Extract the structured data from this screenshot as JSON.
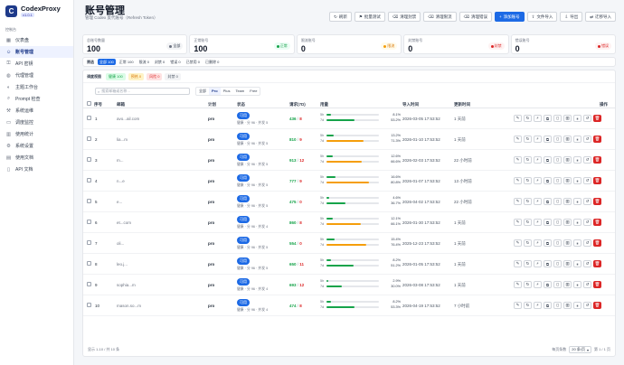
{
  "app": {
    "name": "CodexProxy",
    "version": "v1.0.1",
    "logo_letter": "C"
  },
  "sidebar": {
    "caption": "控制台",
    "items": [
      {
        "label": "仪表盘",
        "icon": "grid-icon",
        "glyph": "▦",
        "active": false
      },
      {
        "label": "账号管理",
        "icon": "users-icon",
        "glyph": "☺",
        "active": true
      },
      {
        "label": "API 密钥",
        "icon": "key-icon",
        "glyph": "⚿",
        "active": false
      },
      {
        "label": "代理管理",
        "icon": "globe-icon",
        "glyph": "◍",
        "active": false
      },
      {
        "label": "主题工作台",
        "icon": "palette-icon",
        "glyph": "◐",
        "active": false
      },
      {
        "label": "Prompt 检查",
        "icon": "search-icon",
        "glyph": "⌕",
        "active": false
      },
      {
        "label": "系统运维",
        "icon": "wrench-icon",
        "glyph": "⚒",
        "active": false
      },
      {
        "label": "调度监控",
        "icon": "monitor-icon",
        "glyph": "▭",
        "active": false
      },
      {
        "label": "使用统计",
        "icon": "chart-icon",
        "glyph": "▥",
        "active": false
      },
      {
        "label": "系统设置",
        "icon": "gear-icon",
        "glyph": "⚙",
        "active": false
      },
      {
        "label": "使用文档",
        "icon": "book-icon",
        "glyph": "▤",
        "active": false
      },
      {
        "label": "API 文档",
        "icon": "file-icon",
        "glyph": "▯",
        "active": false
      }
    ]
  },
  "header": {
    "title": "账号管理",
    "subtitle": "管理 Codex 反代账号（Refresh Token）",
    "buttons": [
      {
        "label": "刷新",
        "icon": "refresh-icon",
        "glyph": "↻",
        "primary": false
      },
      {
        "label": "批量测试",
        "icon": "test-icon",
        "glyph": "⚑",
        "primary": false
      },
      {
        "label": "清理封禁",
        "icon": "trash-icon",
        "glyph": "⌫",
        "primary": false
      },
      {
        "label": "清理限流",
        "icon": "trash-icon",
        "glyph": "⌫",
        "primary": false
      },
      {
        "label": "清理错误",
        "icon": "trash-icon",
        "glyph": "⌫",
        "primary": false
      },
      {
        "label": "添加账号",
        "icon": "plus-icon",
        "glyph": "+",
        "primary": true
      },
      {
        "label": "文件导入",
        "icon": "upload-icon",
        "glyph": "⇪",
        "primary": false
      },
      {
        "label": "导出",
        "icon": "download-icon",
        "glyph": "⇩",
        "primary": false
      },
      {
        "label": "迁移导入",
        "icon": "migrate-icon",
        "glyph": "⇄",
        "primary": false
      }
    ]
  },
  "stats": [
    {
      "label": "总账号数量",
      "value": "100",
      "badge": "全部",
      "badge_color": "#374151",
      "badge_bg": "#f3f4f6",
      "dot": "#6b7280"
    },
    {
      "label": "正常账号",
      "value": "100",
      "badge": "正常",
      "badge_color": "#16a34a",
      "badge_bg": "#ecfdf5",
      "dot": "#16a34a"
    },
    {
      "label": "限流账号",
      "value": "0",
      "badge": "限流",
      "badge_color": "#d97706",
      "badge_bg": "#fffbeb",
      "dot": "#f59e0b"
    },
    {
      "label": "封禁账号",
      "value": "0",
      "badge": "封禁",
      "badge_color": "#dc2626",
      "badge_bg": "#fef2f2",
      "dot": "#dc2626"
    },
    {
      "label": "错误账号",
      "value": "0",
      "badge": "错误",
      "badge_color": "#dc2626",
      "badge_bg": "#fef2f2",
      "dot": "#dc2626"
    }
  ],
  "filter": {
    "label": "筛选",
    "chips": [
      {
        "label": "全部 100",
        "active": true
      },
      {
        "label": "正常 100",
        "active": false
      },
      {
        "label": "限流 0",
        "active": false
      },
      {
        "label": "封禁 0",
        "active": false
      },
      {
        "label": "错误 0",
        "active": false
      },
      {
        "label": "已禁用 0",
        "active": false
      },
      {
        "label": "已删除 0",
        "active": false
      }
    ]
  },
  "dispatch": {
    "label": "调度视图",
    "pills": [
      {
        "label": "健康 100",
        "color": "#16a34a",
        "bg": "#dcfce7"
      },
      {
        "label": "预热 0",
        "color": "#d97706",
        "bg": "#fef3c7"
      },
      {
        "label": "风险 0",
        "color": "#dc2626",
        "bg": "#fee2e2"
      },
      {
        "label": "封禁 0",
        "color": "#4b5563",
        "bg": "#f3f4f6"
      }
    ]
  },
  "search": {
    "placeholder": "搜索邮箱或名称…"
  },
  "plan_filter": [
    {
      "label": "全部",
      "active": false
    },
    {
      "label": "Pro",
      "active": true
    },
    {
      "label": "Plus",
      "active": false
    },
    {
      "label": "Team",
      "active": false
    },
    {
      "label": "Free",
      "active": false
    }
  ],
  "table": {
    "columns": [
      "序号",
      "邮箱",
      "计划",
      "状态",
      "请求(7D)",
      "用量",
      "导入时间",
      "更新时间",
      "操作"
    ],
    "usage_labels": {
      "short": "5h",
      "long": "7d"
    },
    "rows": [
      {
        "idx": "1",
        "email": "avo...ail.com",
        "plan": "pro",
        "status": "可用",
        "sub": "健康 · 分 96 · 并发 5",
        "ok": "436",
        "err": "8",
        "u5": 8.1,
        "u5_text": "8.1%",
        "u7": 53.2,
        "u7_text": "53.2%",
        "imported": "2026-03-05 17:53:52",
        "updated": "1 天前"
      },
      {
        "idx": "2",
        "email": "lia...m",
        "plan": "pro",
        "status": "可用",
        "sub": "健康 · 分 96 · 并发 5",
        "ok": "810",
        "err": "9",
        "u5": 13.2,
        "u5_text": "13.2%",
        "u7": 71.3,
        "u7_text": "71.3%",
        "imported": "2026-01-10 17:53:52",
        "updated": "1 天前"
      },
      {
        "idx": "3",
        "email": "m...",
        "plan": "pro",
        "status": "可用",
        "sub": "健康 · 分 96 · 并发 5",
        "ok": "913",
        "err": "12",
        "u5": 12.6,
        "u5_text": "12.6%",
        "u7": 66.6,
        "u7_text": "66.6%",
        "imported": "2026-02-03 17:53:52",
        "updated": "22 小时前"
      },
      {
        "idx": "4",
        "email": "n...e",
        "plan": "pro",
        "status": "可用",
        "sub": "健康 · 分 96 · 并发 5",
        "ok": "777",
        "err": "9",
        "u5": 16.6,
        "u5_text": "16.6%",
        "u7": 80.8,
        "u7_text": "80.8%",
        "imported": "2026-01-07 17:53:52",
        "updated": "13 小时前"
      },
      {
        "idx": "5",
        "email": "e...",
        "plan": "pro",
        "status": "可用",
        "sub": "健康 · 分 96 · 并发 5",
        "ok": "475",
        "err": "0",
        "u5": 4.6,
        "u5_text": "4.6%",
        "u7": 36.7,
        "u7_text": "36.7%",
        "imported": "2026-04-02 17:53:52",
        "updated": "22 小时前"
      },
      {
        "idx": "6",
        "email": "et...com",
        "plan": "pro",
        "status": "可用",
        "sub": "健康 · 分 96 · 并发 4",
        "ok": "860",
        "err": "8",
        "u5": 12.1,
        "u5_text": "12.1%",
        "u7": 66.1,
        "u7_text": "66.1%",
        "imported": "2026-01-30 17:53:52",
        "updated": "1 天前"
      },
      {
        "idx": "7",
        "email": "oli...",
        "plan": "pro",
        "status": "可用",
        "sub": "健康 · 分 96 · 并发 5",
        "ok": "554",
        "err": "0",
        "u5": 15.4,
        "u5_text": "15.4%",
        "u7": 76.4,
        "u7_text": "76.4%",
        "imported": "2025-12-23 17:53:52",
        "updated": "1 天前"
      },
      {
        "idx": "8",
        "email": "leo.j...",
        "plan": "pro",
        "status": "可用",
        "sub": "健康 · 分 96 · 并发 5",
        "ok": "650",
        "err": "11",
        "u5": 8.2,
        "u5_text": "8.2%",
        "u7": 51.2,
        "u7_text": "51.2%",
        "imported": "2026-01-05 17:53:52",
        "updated": "1 天前"
      },
      {
        "idx": "9",
        "email": "sophia...m",
        "plan": "pro",
        "status": "可用",
        "sub": "健康 · 分 96 · 并发 4",
        "ok": "693",
        "err": "12",
        "u5": 2.9,
        "u5_text": "2.9%",
        "u7": 30.0,
        "u7_text": "30.0%",
        "imported": "2026-03-08 17:53:52",
        "updated": "1 天前"
      },
      {
        "idx": "10",
        "email": "mason.so...m",
        "plan": "pro",
        "status": "可用",
        "sub": "健康 · 分 96 · 并发 4",
        "ok": "474",
        "err": "8",
        "u5": 8.2,
        "u5_text": "8.2%",
        "u7": 53.3,
        "u7_text": "53.3%",
        "imported": "2026-04-19 17:53:52",
        "updated": "7 小时前"
      }
    ],
    "action_icons": [
      {
        "name": "edit-icon",
        "glyph": "✎"
      },
      {
        "name": "refresh-token-icon",
        "glyph": "↻"
      },
      {
        "name": "test-icon",
        "glyph": "⚡"
      },
      {
        "name": "copy-icon",
        "glyph": "⧉"
      },
      {
        "name": "file-icon",
        "glyph": "▯"
      },
      {
        "name": "chart-icon",
        "glyph": "▥"
      },
      {
        "name": "pause-icon",
        "glyph": "⏸"
      },
      {
        "name": "reset-icon",
        "glyph": "↺"
      },
      {
        "name": "delete-icon",
        "glyph": "🗑"
      }
    ]
  },
  "footer": {
    "range_text": "显示 1-10 / 共 10 条",
    "page_size_label": "每页条数",
    "page_size_value": "20 条/页",
    "page_text": "第 1 / 1 页"
  },
  "colors": {
    "accent": "#1d6ae5",
    "ok": "#16a34a",
    "warn": "#f59e0b",
    "danger": "#dc2626"
  }
}
